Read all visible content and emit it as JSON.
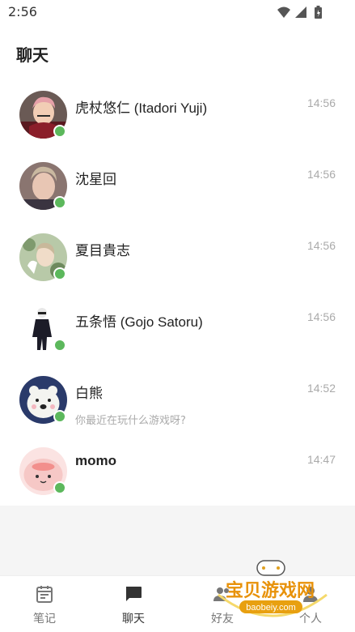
{
  "status_bar": {
    "time": "2:56",
    "icons": [
      "wifi-icon",
      "signal-icon",
      "battery-icon"
    ]
  },
  "header": {
    "title": "聊天"
  },
  "chats": [
    {
      "name": "虎杖悠仁 (Itadori Yuji)",
      "time": "14:56",
      "preview": "",
      "online": true
    },
    {
      "name": "沈星回",
      "time": "14:56",
      "preview": "",
      "online": true
    },
    {
      "name": "夏目貴志",
      "time": "14:56",
      "preview": "",
      "online": true
    },
    {
      "name": "五条悟 (Gojo Satoru)",
      "time": "14:56",
      "preview": "",
      "online": true
    },
    {
      "name": "白熊",
      "time": "14:52",
      "preview": "你最近在玩什么游戏呀?",
      "online": true
    },
    {
      "name": "momo",
      "time": "14:47",
      "preview": "",
      "online": true
    }
  ],
  "nav": {
    "items": [
      {
        "label": "笔记",
        "icon": "notes-icon",
        "active": false
      },
      {
        "label": "聊天",
        "icon": "chat-icon",
        "active": true
      },
      {
        "label": "好友",
        "icon": "friends-icon",
        "active": false
      },
      {
        "label": "个人",
        "icon": "profile-icon",
        "active": false
      }
    ]
  },
  "watermark": {
    "text": "宝贝游戏网",
    "url_text": "baobeiy.com"
  },
  "colors": {
    "online": "#5cb85c",
    "muted": "#aaaaaa",
    "primary_text": "#222222",
    "background": "#f5f5f5"
  }
}
